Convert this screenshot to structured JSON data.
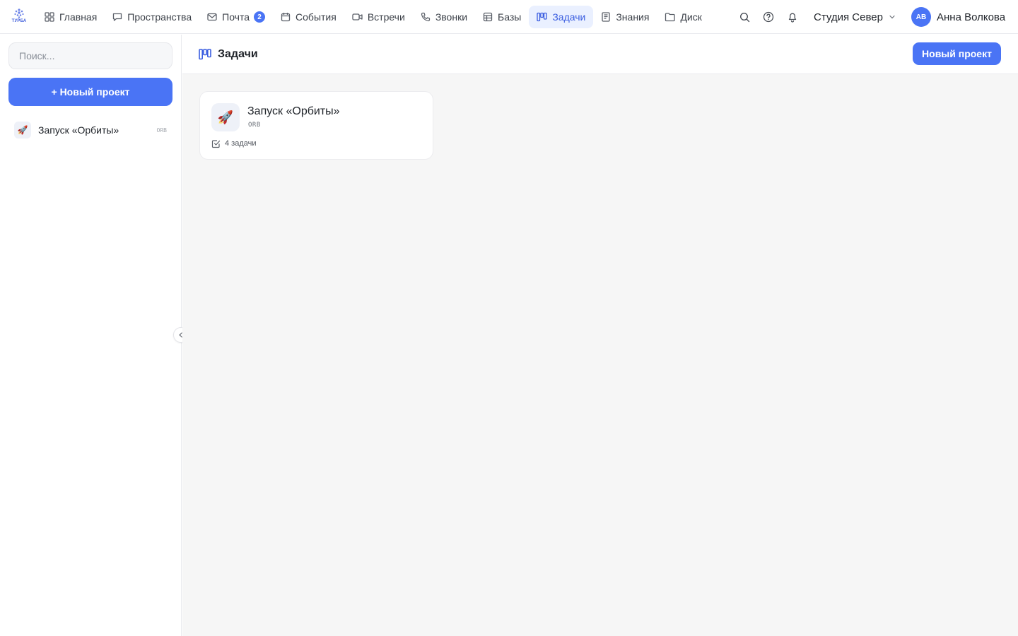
{
  "app": {
    "logo_text": "ТУРБА"
  },
  "nav": {
    "items": [
      {
        "label": "Главная",
        "icon": "grid-icon"
      },
      {
        "label": "Пространства",
        "icon": "chat-icon"
      },
      {
        "label": "Почта",
        "icon": "mail-icon",
        "badge": "2"
      },
      {
        "label": "События",
        "icon": "calendar-icon"
      },
      {
        "label": "Встречи",
        "icon": "video-icon"
      },
      {
        "label": "Звонки",
        "icon": "phone-icon"
      },
      {
        "label": "Базы",
        "icon": "table-icon"
      },
      {
        "label": "Задачи",
        "icon": "kanban-icon",
        "active": true
      },
      {
        "label": "Знания",
        "icon": "notebook-icon"
      },
      {
        "label": "Диск",
        "icon": "folder-icon"
      }
    ]
  },
  "header_right": {
    "workspace": "Студия Север",
    "user": {
      "initials": "АВ",
      "name": "Анна Волкова"
    },
    "icons": [
      "search-icon",
      "help-icon",
      "bell-icon"
    ]
  },
  "sidebar": {
    "search_placeholder": "Поиск...",
    "new_project_label": "+ Новый проект",
    "projects": [
      {
        "emoji": "🚀",
        "name": "Запуск «Орбиты»",
        "key": "ORB"
      }
    ]
  },
  "main": {
    "title": "Задачи",
    "new_project_label": "Новый проект",
    "cards": [
      {
        "emoji": "🚀",
        "name": "Запуск «Орбиты»",
        "key": "ORB",
        "tasks": "4 задачи"
      }
    ]
  },
  "colors": {
    "accent": "#4a74f5",
    "active_bg": "#eaf0ff",
    "active_text": "#3a5de0",
    "main_bg": "#f6f6f6"
  }
}
